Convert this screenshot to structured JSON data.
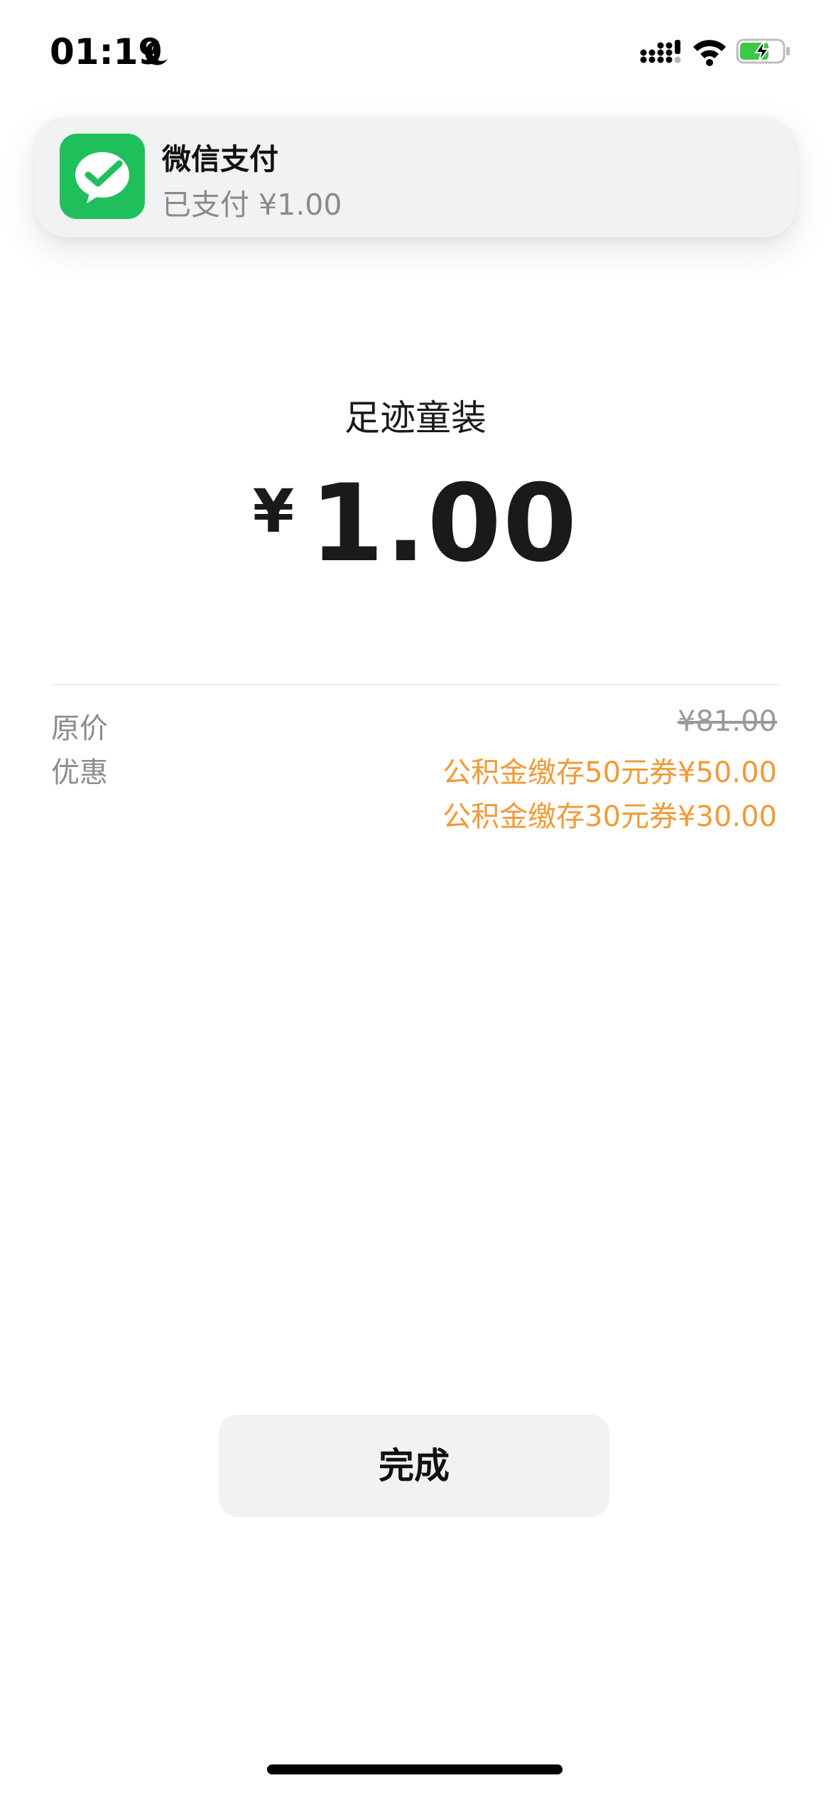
{
  "status_bar": {
    "time": "01:19",
    "icons": [
      "moon-icon",
      "cellular-signal-icon",
      "wifi-icon",
      "battery-charging-icon"
    ]
  },
  "notification": {
    "app_name": "微信支付",
    "message": "已支付 ¥1.00",
    "icon": "wechat-pay-icon",
    "icon_color": "#1fbf5c"
  },
  "payment": {
    "merchant": "足迹童装",
    "currency_symbol": "¥",
    "amount": "1.00"
  },
  "details": {
    "original_price_label": "原价",
    "original_price_value": "¥81.00",
    "discount_label": "优惠",
    "discounts": [
      "公积金缴存50元券¥50.00",
      "公积金缴存30元券¥30.00"
    ]
  },
  "actions": {
    "done_label": "完成"
  },
  "colors": {
    "discount": "#f19a37",
    "muted_text": "#8c8c8c",
    "button_bg": "#f2f2f2"
  }
}
